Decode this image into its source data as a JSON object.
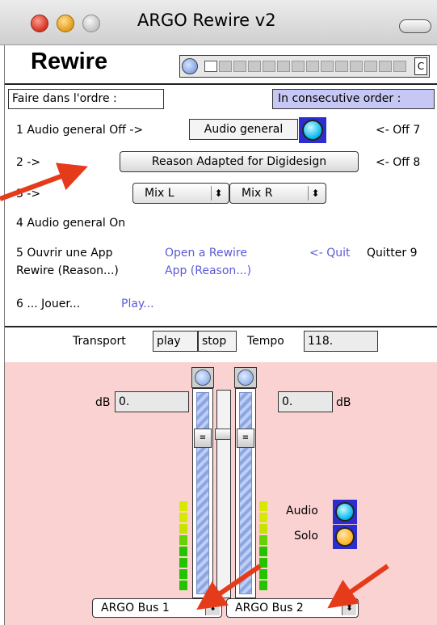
{
  "window": {
    "title": "ARGO Rewire v2"
  },
  "header": {
    "title": "Rewire",
    "meter_end_label": "C"
  },
  "order": {
    "left_label": "Faire dans l'ordre :",
    "right_label": "In consecutive order :"
  },
  "steps": {
    "s1_label": "1 Audio general Off ->",
    "s1_button": "Audio general",
    "s1_right": "<- Off 7",
    "s2_label": "2 ->",
    "s2_button": "Reason Adapted for Digidesign",
    "s2_right": "<- Off 8",
    "s3_label": "3 ->",
    "mix_left": "Mix L",
    "mix_right": "Mix R",
    "s4_label": "4 Audio general On",
    "s5_fr_line1": "5 Ouvrir une App",
    "s5_fr_line2": "Rewire (Reason...)",
    "s5_en_line1": "Open a Rewire",
    "s5_en_line2": "App (Reason...)",
    "s5_quit_en": "<- Quit",
    "s5_quit_fr": "Quitter 9",
    "s6_fr": "6 ... Jouer...",
    "s6_en": "Play..."
  },
  "transport": {
    "label": "Transport",
    "play": "play",
    "stop": "stop",
    "tempo_label": "Tempo",
    "tempo_value": "118."
  },
  "mixer": {
    "db_left_label": "dB",
    "db_left_value": "0.",
    "db_right_value": "0.",
    "db_right_label": "dB",
    "audio_label": "Audio",
    "solo_label": "Solo",
    "bus_left": "ARGO Bus 1",
    "bus_right": "ARGO Bus 2"
  },
  "colors": {
    "accent_blue": "#2d2dcf",
    "audio_cyan": "#00b8ee",
    "solo_orange": "#ffb020",
    "panel_pink": "#fbd2d2",
    "annotation_red": "#e63b1a"
  }
}
